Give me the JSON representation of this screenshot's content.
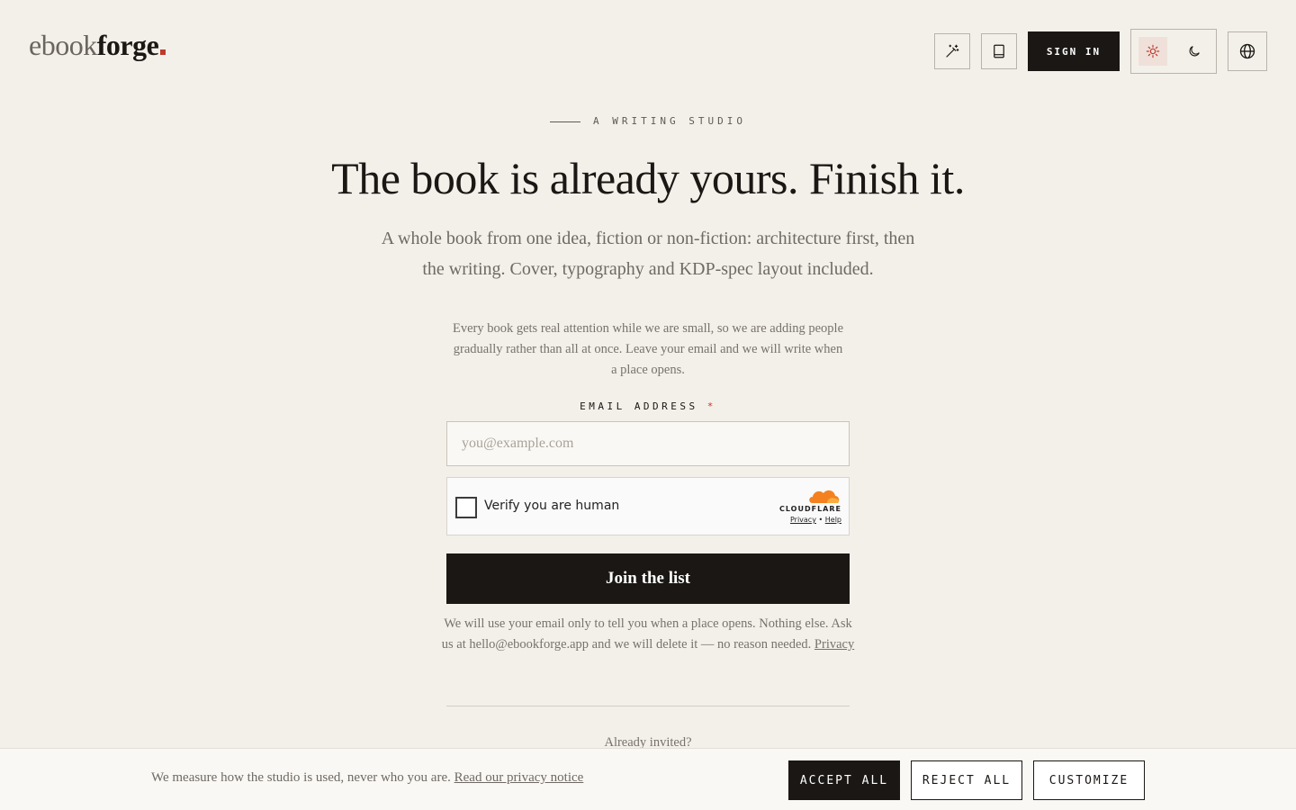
{
  "header": {
    "logo_light": "ebook",
    "logo_bold": "forge",
    "signin_label": "SIGN IN",
    "icons": [
      "magic-wand-icon",
      "book-icon",
      "sun-icon",
      "moon-icon",
      "globe-icon"
    ]
  },
  "hero": {
    "eyebrow": "A WRITING STUDIO",
    "headline": "The book is already yours. Finish it.",
    "subhead": "A whole book from one idea, fiction or non-fiction: architecture first, then the writing. Cover, typography and KDP-spec layout included.",
    "intro": "Every book gets real attention while we are small, so we are adding people gradually rather than all at once. Leave your email and we will write when a place opens."
  },
  "form": {
    "email_label": "EMAIL ADDRESS",
    "required_mark": "*",
    "email_placeholder": "you@example.com",
    "email_value": "",
    "captcha_label": "Verify you are human",
    "captcha_brand": "CLOUDFLARE",
    "captcha_privacy": "Privacy",
    "captcha_sep": "•",
    "captcha_help": "Help",
    "submit_label": "Join the list",
    "fineprint": "We will use your email only to tell you when a place opens. Nothing else. Ask us at hello@ebookforge.app and we will delete it — no reason needed.",
    "privacy_link": "Privacy",
    "already": "Already invited?"
  },
  "cookie": {
    "text": "We measure how the studio is used, never who you are.",
    "link": "Read our privacy notice",
    "accept": "ACCEPT ALL",
    "reject": "REJECT ALL",
    "customize": "CUSTOMIZE"
  },
  "colors": {
    "background": "#f3f0ea",
    "ink": "#1a1714",
    "accent": "#c0392b",
    "cloudflare_orange": "#f48120"
  }
}
